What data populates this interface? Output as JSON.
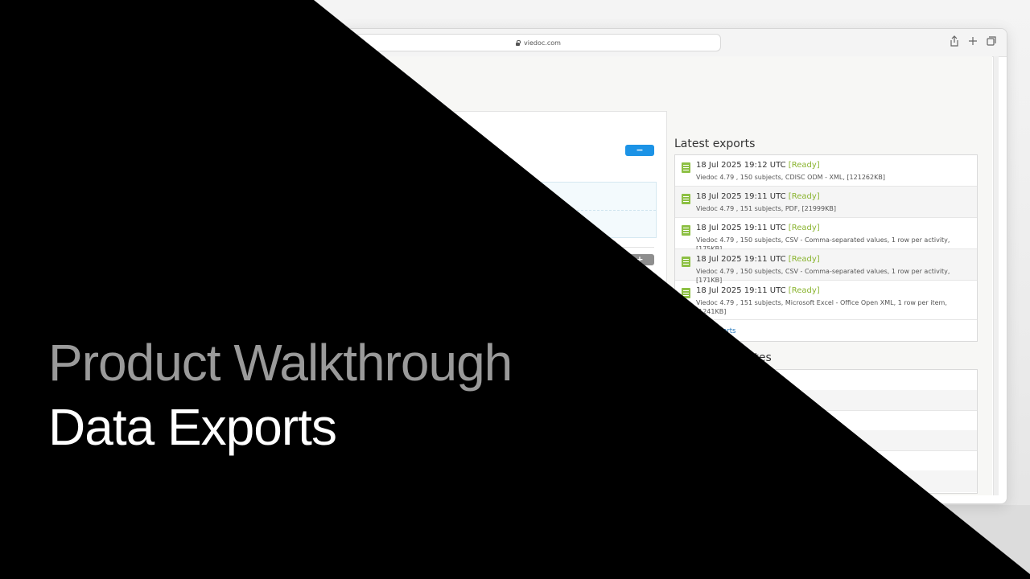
{
  "browser": {
    "url": "viedoc.com",
    "icons": [
      "lock-icon",
      "share-icon",
      "new-tab-icon",
      "tabs-overview-icon"
    ]
  },
  "left_panel": {
    "collapse_label": "−",
    "add_label": "+"
  },
  "latest_exports": {
    "title": "Latest exports",
    "items": [
      {
        "timestamp": "18 Jul 2025 19:12 UTC",
        "status": "[Ready]",
        "details": "Viedoc 4.79 , 150 subjects, CDISC ODM - XML, [121262KB]"
      },
      {
        "timestamp": "18 Jul 2025 19:11 UTC",
        "status": "[Ready]",
        "details": "Viedoc 4.79 , 151 subjects, PDF, [21999KB]"
      },
      {
        "timestamp": "18 Jul 2025 19:11 UTC",
        "status": "[Ready]",
        "details": "Viedoc 4.79 , 150 subjects, CSV - Comma-separated values, 1 row per activity, [175KB]"
      },
      {
        "timestamp": "18 Jul 2025 19:11 UTC",
        "status": "[Ready]",
        "details": "Viedoc 4.79 , 150 subjects, CSV - Comma-separated values, 1 row per activity, [171KB]"
      },
      {
        "timestamp": "18 Jul 2025 19:11 UTC",
        "status": "[Ready]",
        "details": "Viedoc 4.79 , 151 subjects, Microsoft Excel - Office Open XML, 1 row per item, [1241KB]"
      }
    ],
    "view_all": "View all exports"
  },
  "templates": {
    "title": "Export templates"
  },
  "overlay": {
    "line1": "Product Walkthrough",
    "line2": "Data Exports"
  },
  "colors": {
    "accent_blue": "#1c93e6",
    "ready_green": "#8ab42f",
    "doc_icon_green": "#8dc044",
    "overlay_black": "#000000"
  }
}
